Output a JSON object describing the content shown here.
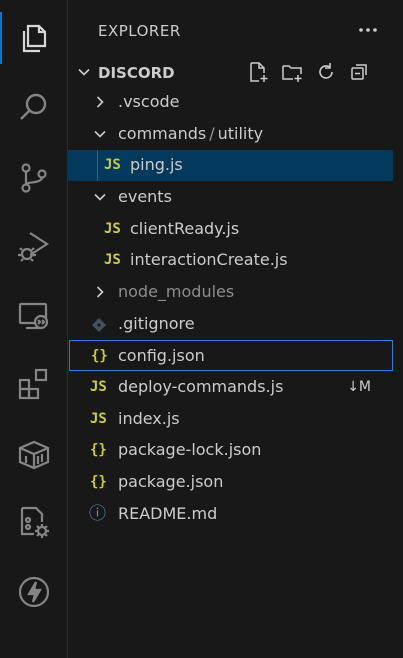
{
  "explorer": {
    "title": "EXPLORER",
    "section": "DISCORD"
  },
  "activity": [
    {
      "name": "explorer-icon"
    },
    {
      "name": "search-icon"
    },
    {
      "name": "source-control-icon"
    },
    {
      "name": "run-debug-icon"
    },
    {
      "name": "remote-explorer-icon"
    },
    {
      "name": "extensions-icon"
    },
    {
      "name": "containers-icon"
    },
    {
      "name": "settings-sync-icon"
    },
    {
      "name": "thunder-client-icon"
    }
  ],
  "tree": {
    "vscode": ".vscode",
    "commands": "commands",
    "path_sep": "/",
    "utility": "utility",
    "ping": "ping.js",
    "events": "events",
    "clientReady": "clientReady.js",
    "interactionCreate": "interactionCreate.js",
    "node_modules": "node_modules",
    "gitignore": ".gitignore",
    "config": "config.json",
    "deploy": "deploy-commands.js",
    "deploy_badge": "↓M",
    "index": "index.js",
    "package_lock": "package-lock.json",
    "package": "package.json",
    "readme": "README.md"
  },
  "icons": {
    "js_label": "JS",
    "json_label": "{}",
    "info_label": "ⓘ"
  },
  "colors": {
    "selected_bg": "#04395e",
    "focus_border": "#2f7bd8",
    "accent": "#0078d4"
  }
}
